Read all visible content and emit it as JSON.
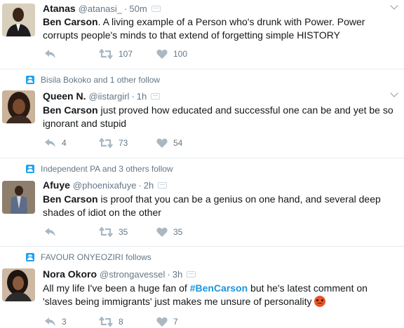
{
  "tweets": [
    {
      "context": "",
      "name": "Atanas",
      "handle": "@atanasi_",
      "time": "50m",
      "bold_lead": "Ben Carson",
      "text_before_tag": ".  A  living example of a Person who's drunk with  Power. Power corrupts people's minds to that extend of forgetting simple HISTORY",
      "hashtag": "",
      "text_after_tag": "",
      "emoji": "",
      "replies": "",
      "retweets": "107",
      "likes": "100"
    },
    {
      "context": "Bisila Bokoko and 1 other follow",
      "name": "Queen N.",
      "handle": "@iistargirl",
      "time": "1h",
      "bold_lead": "Ben Carson",
      "text_before_tag": " just proved how educated and successful one can be and yet be so ignorant and stupid",
      "hashtag": "",
      "text_after_tag": "",
      "emoji": "",
      "replies": "4",
      "retweets": "73",
      "likes": "54"
    },
    {
      "context": "Independent PA and 3 others follow",
      "name": "Afuye",
      "handle": "@phoenixafuye",
      "time": "2h",
      "bold_lead": "Ben Carson",
      "text_before_tag": " is proof that you can be a genius on one hand, and several deep shades of idiot on the other",
      "hashtag": "",
      "text_after_tag": "",
      "emoji": "",
      "replies": "",
      "retweets": "35",
      "likes": "35"
    },
    {
      "context": "FAVOUR ONYEOZIRI follows",
      "name": "Nora Okoro",
      "handle": "@strongavessel",
      "time": "3h",
      "bold_lead": "",
      "text_before_tag": "All my life I've been a huge fan of ",
      "hashtag": "#BenCarson",
      "text_after_tag": " but he's latest comment on 'slaves being immigrants' just makes me unsure of personality",
      "emoji": "angry-face",
      "replies": "3",
      "retweets": "8",
      "likes": "7"
    }
  ],
  "separator": "·",
  "colors": {
    "accent": "#1da1f2",
    "hashtag": "#1b95e0",
    "muted": "#657786",
    "border": "#e6ecf0"
  }
}
